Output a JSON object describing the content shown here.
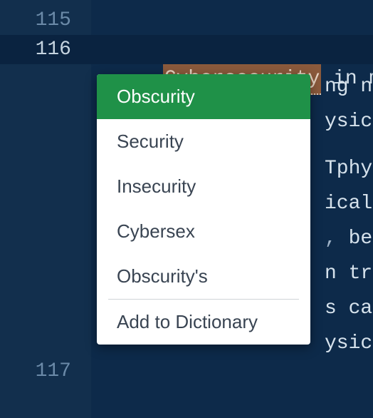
{
  "gutter": {
    "lines": [
      {
        "num": "115",
        "active": false
      },
      {
        "num": "116",
        "active": true
      },
      {
        "num": "117",
        "active": false
      }
    ]
  },
  "code": {
    "misspelled_word": "Cybersecurity",
    "line116_rest": " in mole",
    "frags": {
      "r1": "ng n",
      "r2": "ysic",
      "r3": "Tphy",
      "r4": "ical",
      "r5a": ", ",
      "r5b": "be",
      "r6": "n tr",
      "r7": "s ca",
      "r8": "ysic"
    }
  },
  "menu": {
    "items": [
      {
        "label": "Obscurity",
        "selected": true
      },
      {
        "label": "Security",
        "selected": false
      },
      {
        "label": "Insecurity",
        "selected": false
      },
      {
        "label": "Cybersex",
        "selected": false
      },
      {
        "label": "Obscurity's",
        "selected": false
      }
    ],
    "add_to_dict": "Add to Dictionary"
  }
}
